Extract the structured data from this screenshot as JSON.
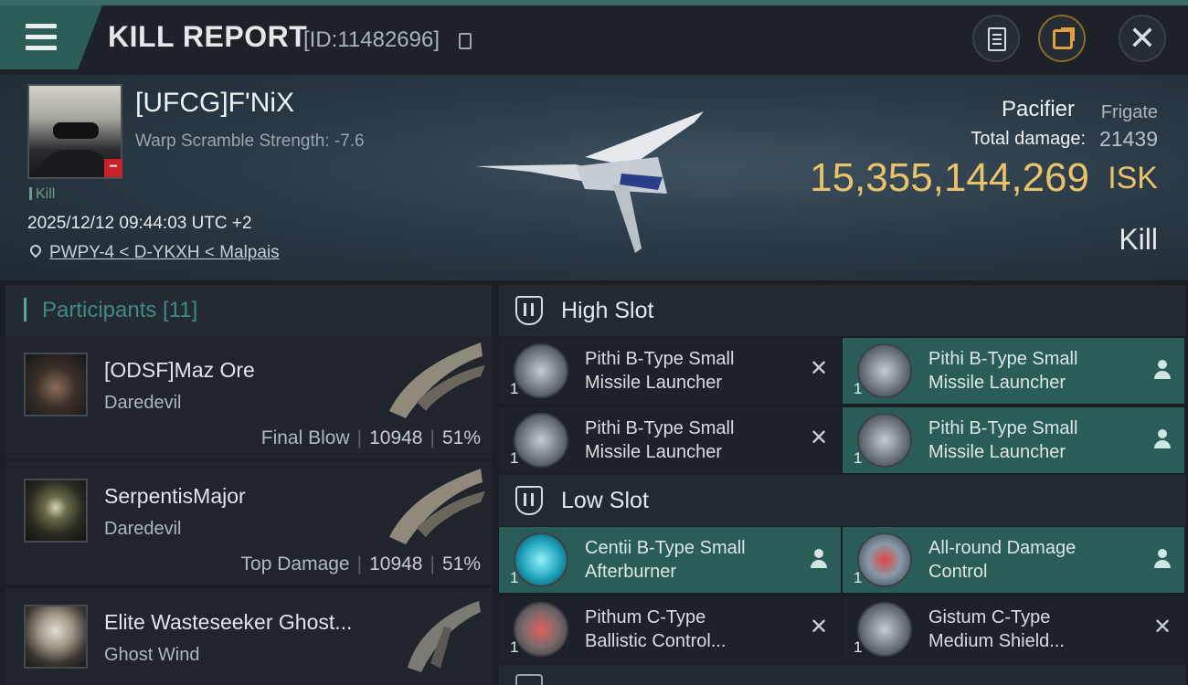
{
  "header": {
    "title": "KILL REPORT",
    "report_id": "[ID:11482696]"
  },
  "victim": {
    "name": "[UFCG]F'NiX",
    "warp_scramble": "Warp Scramble Strength: -7.6",
    "status_tag": "Kill",
    "datetime": "2025/12/12 09:44:03 UTC +2",
    "location": "PWPY-4 < D-YKXH < Malpais"
  },
  "ship": {
    "name": "Pacifier",
    "class": "Frigate",
    "total_damage_label": "Total damage:",
    "total_damage": "21439",
    "isk_value": "15,355,144,269",
    "isk_unit": "ISK",
    "result": "Kill"
  },
  "participants": {
    "title": "Participants [11]",
    "rows": [
      {
        "name": "[ODSF]Maz Ore",
        "ship": "Daredevil",
        "role": "Final Blow",
        "damage": "10948",
        "percent": "51%"
      },
      {
        "name": "SerpentisMajor",
        "ship": "Daredevil",
        "role": "Top Damage",
        "damage": "10948",
        "percent": "51%"
      },
      {
        "name": "Elite Wasteseeker Ghost...",
        "ship": "Ghost Wind"
      }
    ]
  },
  "slots": {
    "high": {
      "label": "High Slot",
      "modules": [
        {
          "name_line1": "Pithi B-Type Small",
          "name_line2": "Missile Launcher",
          "qty": "1",
          "state": "destroyed"
        },
        {
          "name_line1": "Pithi B-Type Small",
          "name_line2": "Missile Launcher",
          "qty": "1",
          "state": "dropped"
        },
        {
          "name_line1": "Pithi B-Type Small",
          "name_line2": "Missile Launcher",
          "qty": "1",
          "state": "destroyed"
        },
        {
          "name_line1": "Pithi B-Type Small",
          "name_line2": "Missile Launcher",
          "qty": "1",
          "state": "dropped"
        }
      ]
    },
    "low": {
      "label": "Low Slot",
      "modules": [
        {
          "name_line1": "Centii B-Type Small",
          "name_line2": "Afterburner",
          "qty": "1",
          "state": "dropped"
        },
        {
          "name_line1": "All-round Damage",
          "name_line2": "Control",
          "qty": "1",
          "state": "dropped"
        },
        {
          "name_line1": "Pithum C-Type",
          "name_line2": "Ballistic Control...",
          "qty": "1",
          "state": "destroyed"
        },
        {
          "name_line1": "Gistum C-Type",
          "name_line2": "Medium Shield...",
          "qty": "1",
          "state": "destroyed"
        }
      ]
    }
  },
  "icons": {
    "menu": "hamburger-menu-icon",
    "copy": "copy-icon",
    "document": "document-icon",
    "share": "share-icon",
    "close": "close-icon",
    "location": "location-pin-icon",
    "slot": "slot-shield-icon",
    "destroyed": "x-icon",
    "dropped": "pilot-icon"
  },
  "colors": {
    "accent_teal": "#2a5d58",
    "isk_gold": "#e8c36a",
    "warning_red": "#c8232a"
  }
}
